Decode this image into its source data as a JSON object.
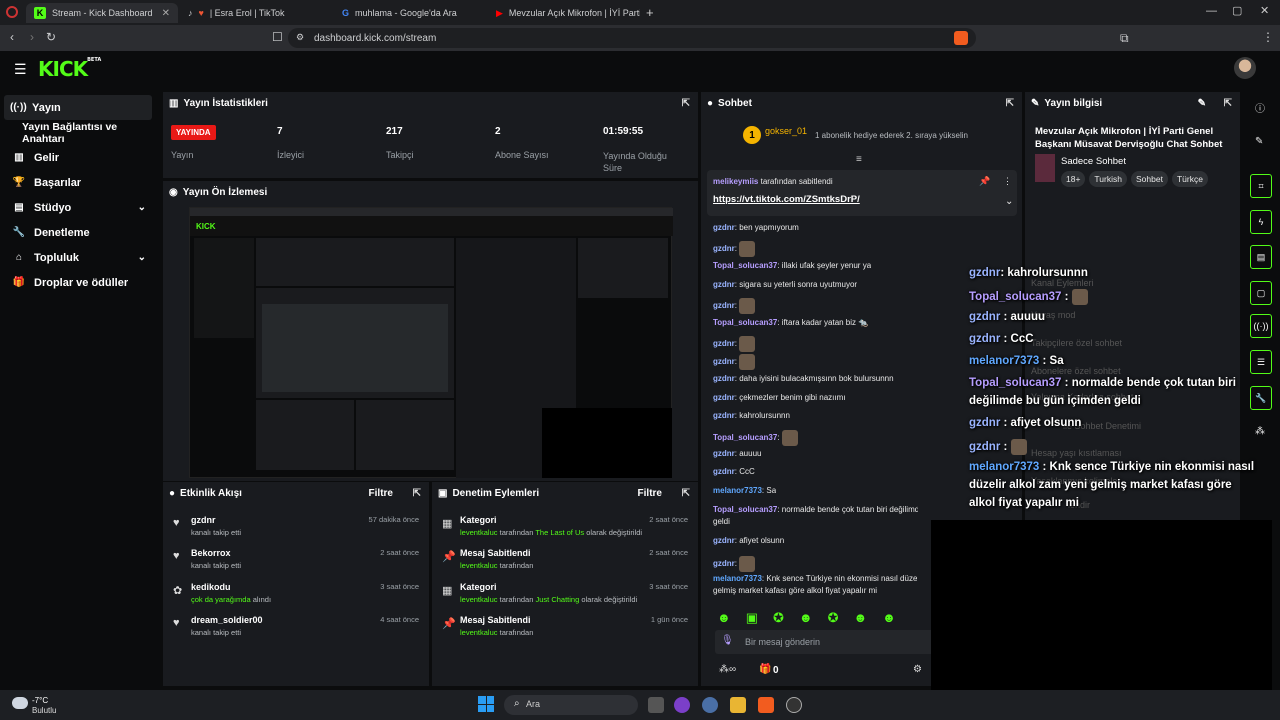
{
  "browser": {
    "tabs": [
      {
        "title": "Stream - Kick Dashboard",
        "active": true
      },
      {
        "title": "| Esra Erol | TikTok"
      },
      {
        "title": "muhlama - Google'da Ara"
      },
      {
        "title": "Mevzular Açık Mikrofon | İYİ Parti Ge"
      }
    ],
    "url": "dashboard.kick.com/stream"
  },
  "brand": {
    "logo": "KICK",
    "beta": "BETA",
    "accent": "#53fc18"
  },
  "sidebar": {
    "items": [
      {
        "label": "Yayın",
        "icon": "broadcast-icon"
      },
      {
        "label": "Yayın Bağlantısı ve Anahtarı"
      },
      {
        "label": "Gelir",
        "icon": "chart-icon"
      },
      {
        "label": "Başarılar",
        "icon": "trophy-icon"
      },
      {
        "label": "Stüdyo",
        "icon": "studio-icon"
      },
      {
        "label": "Denetleme",
        "icon": "wrench-icon"
      },
      {
        "label": "Topluluk",
        "icon": "community-icon"
      },
      {
        "label": "Droplar ve ödüller",
        "icon": "gift-icon"
      }
    ]
  },
  "stats": {
    "title": "Yayın İstatistikleri",
    "live_badge": "YAYINDA",
    "live_label": "Yayın",
    "viewers": "7",
    "viewers_label": "İzleyici",
    "followers": "217",
    "followers_label": "Takipçi",
    "subs": "2",
    "subs_label": "Abone Sayısı",
    "uptime": "01:59:55",
    "uptime_label": "Yayında Olduğu Süre"
  },
  "preview": {
    "title": "Yayın Ön İzlemesi"
  },
  "activity": {
    "title": "Etkinlik Akışı",
    "filter": "Filtre",
    "items": [
      {
        "name": "gzdnr",
        "sub": "kanalı takip etti",
        "time": "57 dakika önce"
      },
      {
        "name": "Bekorrox",
        "sub": "kanalı takip etti",
        "time": "2 saat önce"
      },
      {
        "name": "kedikodu",
        "sub_hl": "çok da yarağımda",
        "sub_rest": " alındı",
        "time": "3 saat önce"
      },
      {
        "name": "dream_soldier00",
        "sub": "kanalı takip etti",
        "time": "4 saat önce"
      }
    ]
  },
  "moderation": {
    "title": "Denetim Eylemleri",
    "filter": "Filtre",
    "items": [
      {
        "name": "Kategori",
        "user": "leventkaluc",
        "mid": " tarafından ",
        "hl": "The Last of Us",
        "tail": " olarak değiştirildi",
        "time": "2 saat önce"
      },
      {
        "name": "Mesaj Sabitlendi",
        "user": "leventkaluc",
        "mid": " tarafından",
        "hl": "",
        "tail": "",
        "time": "2 saat önce"
      },
      {
        "name": "Kategori",
        "user": "leventkaluc",
        "mid": " tarafından ",
        "hl": "Just Chatting",
        "tail": " olarak değiştirildi",
        "time": "3 saat önce"
      },
      {
        "name": "Mesaj Sabitlendi",
        "user": "leventkaluc",
        "mid": " tarafından",
        "hl": "",
        "tail": "",
        "time": "1 gün önce"
      }
    ]
  },
  "chat": {
    "title": "Sohbet",
    "top_user": "gokser_01",
    "top_count": "1",
    "gift_note": "1 abonelik hediye ederek 2. sıraya yükselin",
    "pinned_by": "melikeymiis",
    "pinned_suffix": " tarafından sabitlendi",
    "pinned_link": "https://vt.tiktok.com/ZSmtksDrP/",
    "messages": [
      {
        "u": "gzdnr",
        "t": ": ben yapmıyorum"
      },
      {
        "u": "gzdnr",
        "t": ": "
      },
      {
        "u": "Topal_solucan37",
        "t": ": illaki ufak şeyler yenur ya"
      },
      {
        "u": "gzdnr",
        "t": ": sigara su yeterli sonra uyutmuyor"
      },
      {
        "u": "gzdnr",
        "t": ": "
      },
      {
        "u": "Topal_solucan37",
        "t": ": iftara kadar yatan biz 🐀"
      },
      {
        "u": "gzdnr",
        "t": ": "
      },
      {
        "u": "gzdnr",
        "t": ": "
      },
      {
        "u": "gzdnr",
        "t": ": daha iyisini bulacakmışsınn bok bulursunnn"
      },
      {
        "u": "gzdnr",
        "t": ": çekmezlerr benim gibi nazıımı"
      },
      {
        "u": "gzdnr",
        "t": ": kahrolursunnn"
      },
      {
        "u": "Topal_solucan37",
        "t": ": "
      },
      {
        "u": "gzdnr",
        "t": ": auuuu"
      },
      {
        "u": "gzdnr",
        "t": ": CcC"
      },
      {
        "u": "melanor7373",
        "t": ": Sa"
      },
      {
        "u": "Topal_solucan37",
        "t": ": normalde bende çok tutan biri değilimde bu gün içimden"
      },
      {
        "u": "",
        "t": "geldi"
      },
      {
        "u": "gzdnr",
        "t": ": afiyet olsunn"
      },
      {
        "u": "gzdnr",
        "t": ": "
      },
      {
        "u": "melanor7373",
        "t": ": Knk sence Türkiye nin ekonmisi nasıl düze"
      },
      {
        "u": "",
        "t": "gelmiş market kafası göre alkol fiyat yapalır mi"
      }
    ],
    "input_placeholder": "Bir mesaj gönderin",
    "footer_count": "0"
  },
  "stream_info": {
    "title": "Yayın bilgisi",
    "stream_title": "Mevzular Açık Mikrofon | İYİ Parti Genel Başkanı Müsavat Dervişoğlu Chat Sohbet",
    "category": "Sadece Sohbet",
    "tags": [
      "18+",
      "Turkish",
      "Sohbet",
      "Türkçe"
    ]
  },
  "overlay": {
    "ghost": [
      "Kanal Eylemleri",
      "Yavaş mod",
      "Takipçilere özel sohbet",
      "Abonelere özel sohbet",
      "Yalnızca Kadarlıra sohbet",
      "ile Sohbet Denetimi",
      "Hesap yaşı kısıtlaması",
      "Yasaklanmış kelimeler",
      "lendir"
    ],
    "lines": [
      {
        "u": "gzdnr",
        "t": ": kahrolursunnn",
        "c": "n1"
      },
      {
        "u": "Topal_solucan37",
        "t": " : ",
        "c": "n2"
      },
      {
        "u": "gzdnr",
        "t": " : auuuu",
        "c": "n1"
      },
      {
        "u": "gzdnr",
        "t": " : CcC",
        "c": "n1"
      },
      {
        "u": "melanor7373",
        "t": " : Sa",
        "c": "n3"
      },
      {
        "u": "Topal_solucan37",
        "t": " : normalde bende çok tutan biri",
        "c": "n2"
      },
      {
        "u": "",
        "t": "değilimde bu gün içimden geldi",
        "c": ""
      },
      {
        "u": "gzdnr",
        "t": " : afiyet olsunn",
        "c": "n1"
      },
      {
        "u": "gzdnr",
        "t": " : ",
        "c": "n1"
      },
      {
        "u": "melanor7373",
        "t": " : Knk sence Türkiye nin ekonmisi nasıl",
        "c": "n3"
      },
      {
        "u": "",
        "t": "düzelir alkol zam yeni gelmiş market kafası göre",
        "c": ""
      },
      {
        "u": "",
        "t": "alkol fiyat yapalır mi",
        "c": ""
      }
    ]
  },
  "taskbar": {
    "weather_temp": "-7°C",
    "weather_label": "Bulutlu",
    "search": "Ara"
  }
}
